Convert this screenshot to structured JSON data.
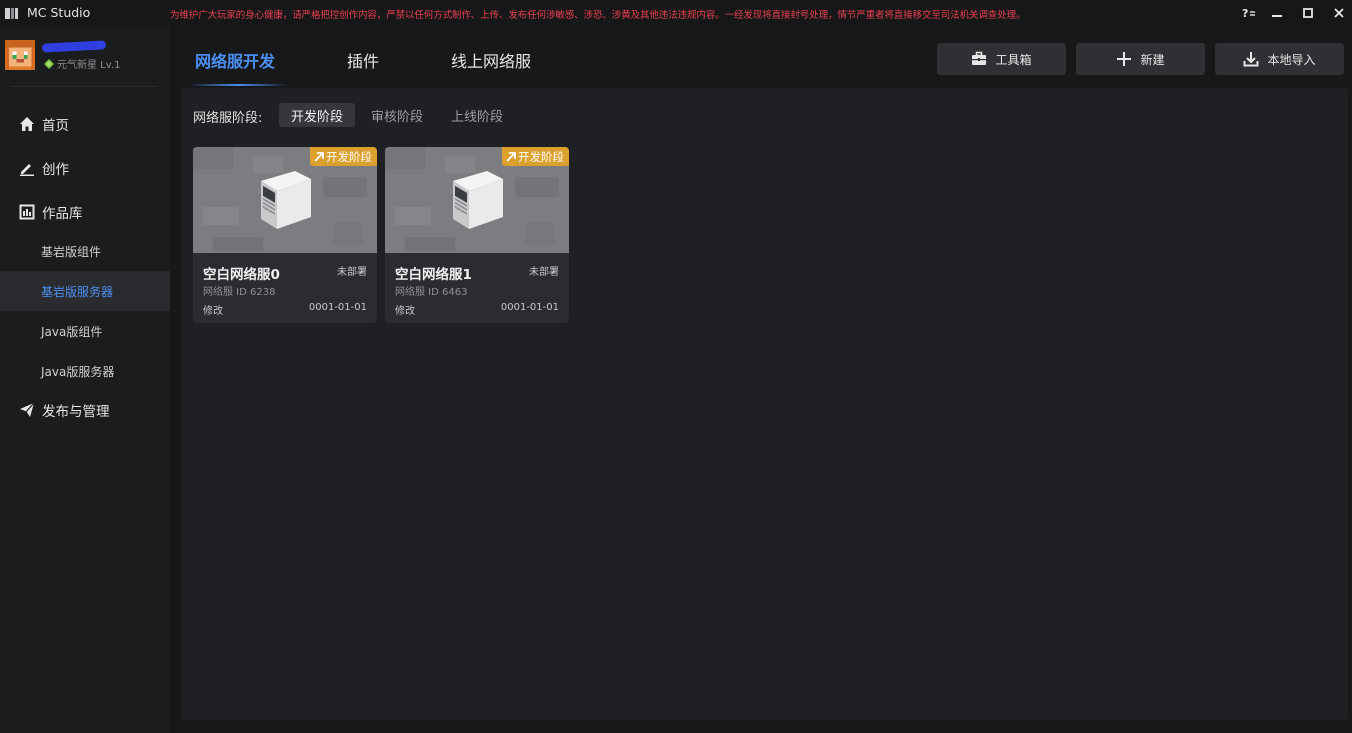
{
  "window": {
    "title": "MC Studio",
    "notice": "为维护广大玩家的身心健康，请严格把控创作内容，严禁以任何方式制作、上传、发布任何涉敏感、涉恐、涉黄及其他违法违规内容。一经发现将直接封号处理，情节严重者将直接移交至司法机关调查处理。",
    "help_label": "?",
    "minimize_label": "—",
    "maximize_label": "□",
    "close_label": "✕"
  },
  "user": {
    "level_text": "元气新星 Lv.1"
  },
  "sidebar": {
    "items": [
      {
        "label": "首页",
        "icon": "home-icon"
      },
      {
        "label": "创作",
        "icon": "pencil-icon"
      },
      {
        "label": "作品库",
        "icon": "library-icon"
      }
    ],
    "sub_items": [
      {
        "label": "基岩版组件"
      },
      {
        "label": "基岩版服务器"
      },
      {
        "label": "Java版组件"
      },
      {
        "label": "Java版服务器"
      }
    ],
    "publish": {
      "label": "发布与管理",
      "icon": "send-icon"
    }
  },
  "tabs": [
    {
      "label": "网络服开发"
    },
    {
      "label": "插件"
    },
    {
      "label": "线上网络服"
    }
  ],
  "toolbar": {
    "toolbox_label": "工具箱",
    "new_label": "新建",
    "import_label": "本地导入"
  },
  "stages": {
    "label": "网络服阶段:",
    "options": [
      {
        "label": "开发阶段"
      },
      {
        "label": "审核阶段"
      },
      {
        "label": "上线阶段"
      }
    ]
  },
  "cards": [
    {
      "badge": "开发阶段",
      "title": "空白网络服0",
      "status": "未部署",
      "id_text": "网络服 ID 6238",
      "modified_label": "修改",
      "date": "0001-01-01"
    },
    {
      "badge": "开发阶段",
      "title": "空白网络服1",
      "status": "未部署",
      "id_text": "网络服 ID 6463",
      "modified_label": "修改",
      "date": "0001-01-01"
    }
  ],
  "colors": {
    "accent": "#4b8ff5",
    "notice": "#ea4050",
    "badge": "#dca02e",
    "background": "#17181a",
    "panel": "#1f2023",
    "card": "#2b2c30"
  }
}
